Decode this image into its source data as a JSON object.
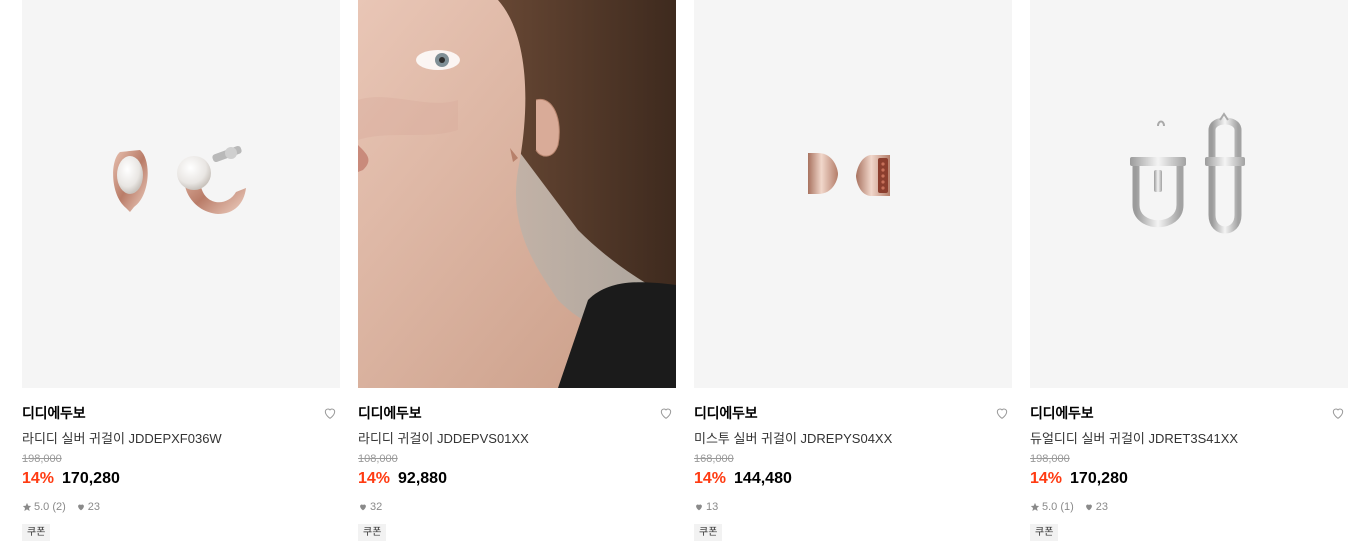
{
  "products": [
    {
      "brand": "디디에두보",
      "name": "라디디 실버 귀걸이 JDDEPXF036W",
      "original_price": "198,000",
      "discount": "14%",
      "price": "170,280",
      "rating": "5.0 (2)",
      "likes": "23",
      "coupon": "쿠폰",
      "image": "rose-gold-pearl-earrings"
    },
    {
      "brand": "디디에두보",
      "name": "라디디 귀걸이 JDDEPVS01XX",
      "original_price": "108,000",
      "discount": "14%",
      "price": "92,880",
      "likes": "32",
      "coupon": "쿠폰",
      "image": "model-wearing-earring"
    },
    {
      "brand": "디디에두보",
      "name": "미스투 실버 귀걸이 JDREPYS04XX",
      "original_price": "168,000",
      "discount": "14%",
      "price": "144,480",
      "likes": "13",
      "coupon": "쿠폰",
      "image": "rose-gold-d-earrings"
    },
    {
      "brand": "디디에두보",
      "name": "듀얼디디 실버 귀걸이 JDRET3S41XX",
      "original_price": "198,000",
      "discount": "14%",
      "price": "170,280",
      "rating": "5.0 (1)",
      "likes": "23",
      "coupon": "쿠폰",
      "image": "silver-link-earrings"
    }
  ],
  "colors": {
    "discount": "#ff3b12",
    "thumb_bg": "#f5f5f5"
  }
}
